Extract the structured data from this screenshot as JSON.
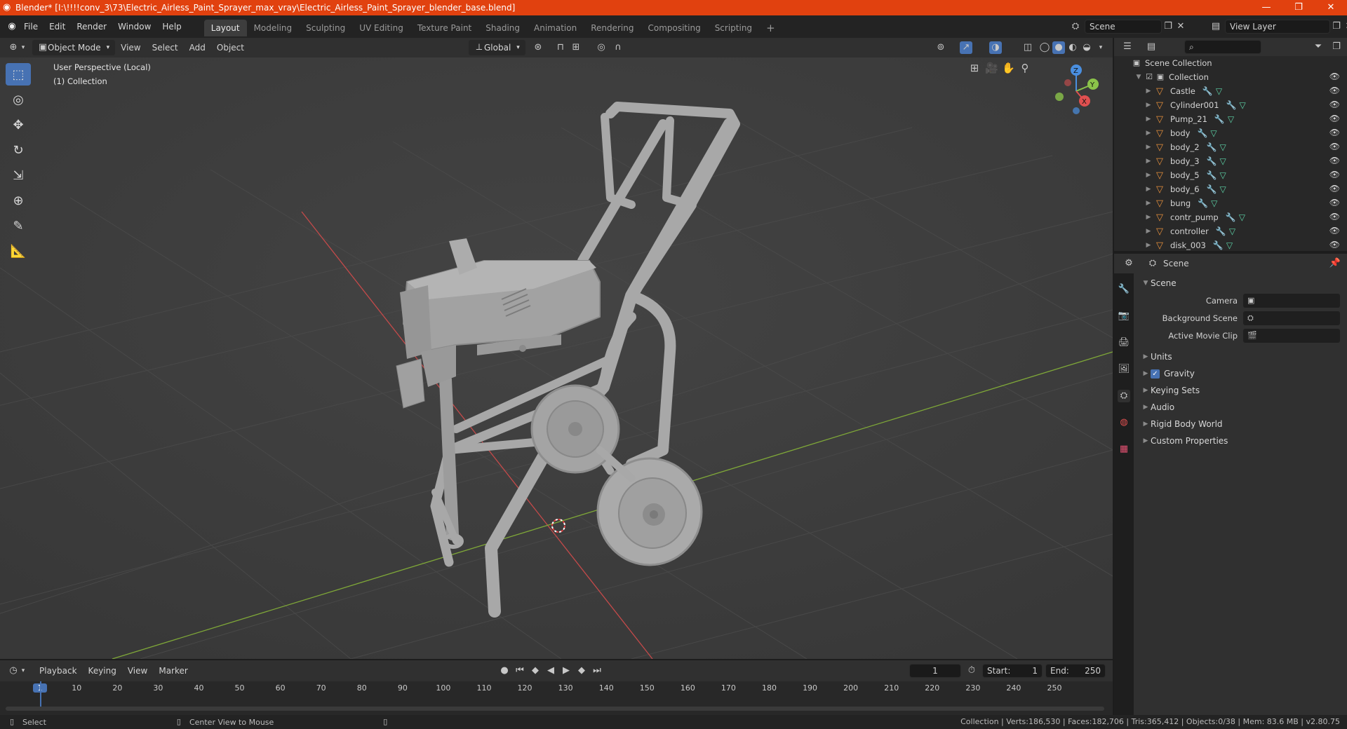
{
  "window": {
    "title": "Blender* [I:\\!!!!conv_3\\73\\Electric_Airless_Paint_Sprayer_max_vray\\Electric_Airless_Paint_Sprayer_blender_base.blend]",
    "minimize": "—",
    "maximize": "❐",
    "close": "✕"
  },
  "menu": {
    "items": [
      "File",
      "Edit",
      "Render",
      "Window",
      "Help"
    ],
    "workspaces": [
      "Layout",
      "Modeling",
      "Sculpting",
      "UV Editing",
      "Texture Paint",
      "Shading",
      "Animation",
      "Rendering",
      "Compositing",
      "Scripting"
    ],
    "active_workspace": "Layout",
    "add_tab": "+",
    "scene_label": "Scene",
    "view_layer_label": "View Layer"
  },
  "viewport_header": {
    "mode": "Object Mode",
    "menus": [
      "View",
      "Select",
      "Add",
      "Object"
    ],
    "orientation": "Global"
  },
  "viewport": {
    "perspective": "User Perspective (Local)",
    "collection": "(1) Collection",
    "gizmo": {
      "x": "X",
      "y": "Y",
      "z": "Z"
    }
  },
  "outliner": {
    "root": "Scene Collection",
    "collection": "Collection",
    "objects": [
      "Castle",
      "Cylinder001",
      "Pump_21",
      "body",
      "body_2",
      "body_3",
      "body_5",
      "body_6",
      "bung",
      "contr_pump",
      "controller",
      "disk_003"
    ]
  },
  "properties": {
    "header": "Scene",
    "section": "Scene",
    "fields": [
      {
        "label": "Camera"
      },
      {
        "label": "Background Scene"
      },
      {
        "label": "Active Movie Clip"
      }
    ],
    "subsections": [
      "Units",
      "Gravity",
      "Keying Sets",
      "Audio",
      "Rigid Body World",
      "Custom Properties"
    ],
    "gravity_checked": true
  },
  "timeline": {
    "menus": [
      "Playback",
      "Keying",
      "View",
      "Marker"
    ],
    "current_frame": "1",
    "start_label": "Start:",
    "start": "1",
    "end_label": "End:",
    "end": "250",
    "ticks": [
      "1",
      "10",
      "20",
      "30",
      "40",
      "50",
      "60",
      "70",
      "80",
      "90",
      "100",
      "110",
      "120",
      "130",
      "140",
      "150",
      "160",
      "170",
      "180",
      "190",
      "200",
      "210",
      "220",
      "230",
      "240",
      "250"
    ]
  },
  "statusbar": {
    "select": "Select",
    "center_view": "Center View to Mouse",
    "stats": "Collection | Verts:186,530 | Faces:182,706 | Tris:365,412 | Objects:0/38 | Mem: 83.6 MB | v2.80.75"
  },
  "colors": {
    "titlebar": "#e1410f",
    "accent": "#4772b3",
    "viewport_bg": "#3e3e3e",
    "x_axis": "#e05050",
    "y_axis": "#8bc34a",
    "z_axis": "#4a8fe0"
  }
}
